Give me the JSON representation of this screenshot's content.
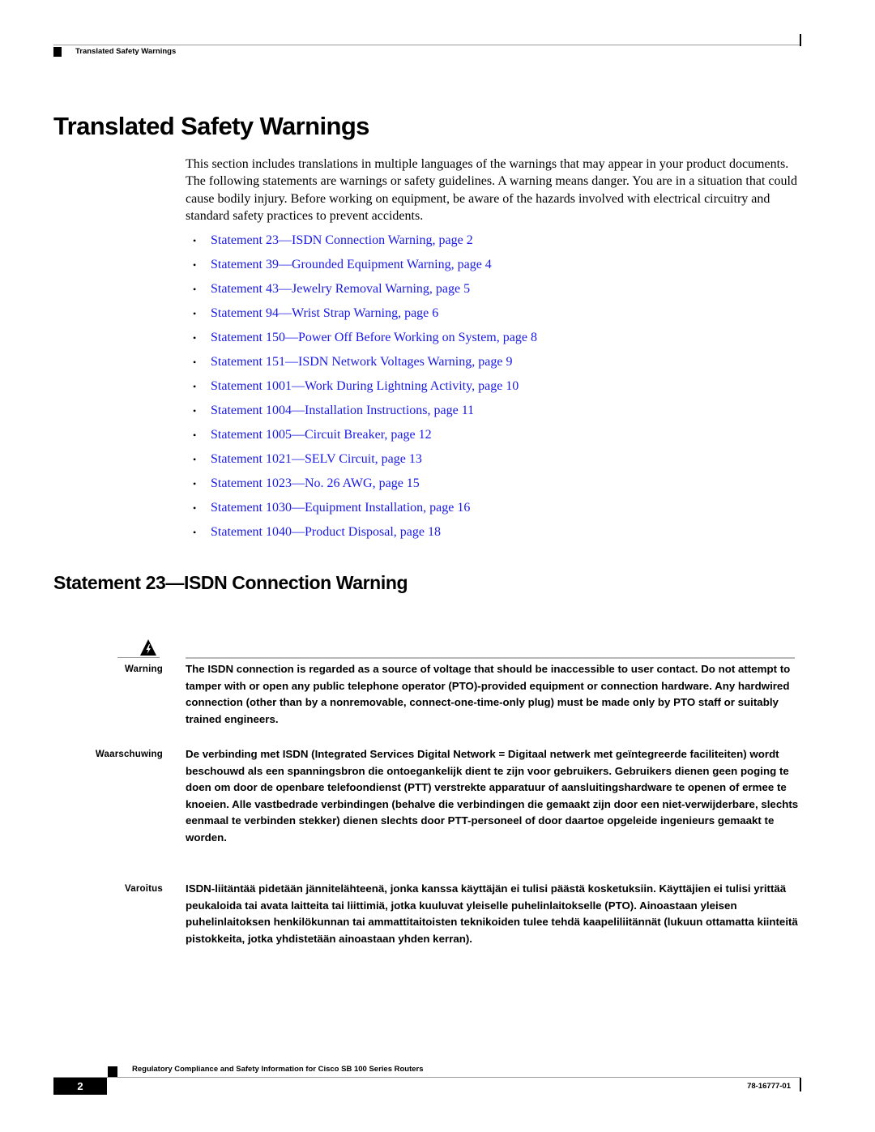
{
  "header": {
    "running_title": "Translated Safety Warnings"
  },
  "page_title": "Translated Safety Warnings",
  "intro": "This section includes translations in multiple languages of the warnings that may appear in your product documents. The following statements are warnings or safety guidelines. A warning means danger. You are in a situation that could cause bodily injury. Before working on equipment, be aware of the hazards involved with electrical circuitry and standard safety practices to prevent accidents.",
  "toc": [
    {
      "label": "Statement 23—ISDN Connection Warning, page 2"
    },
    {
      "label": "Statement 39—Grounded Equipment Warning, page 4"
    },
    {
      "label": "Statement 43—Jewelry Removal Warning, page 5"
    },
    {
      "label": "Statement 94—Wrist Strap Warning, page 6"
    },
    {
      "label": "Statement 150—Power Off Before Working on System, page 8"
    },
    {
      "label": "Statement 151—ISDN Network Voltages Warning, page 9"
    },
    {
      "label": "Statement 1001—Work During Lightning Activity, page 10"
    },
    {
      "label": "Statement 1004—Installation Instructions, page 11"
    },
    {
      "label": "Statement 1005—Circuit Breaker, page 12"
    },
    {
      "label": "Statement 1021—SELV Circuit, page 13"
    },
    {
      "label": "Statement 1023—No. 26 AWG, page 15"
    },
    {
      "label": "Statement 1030—Equipment Installation, page 16"
    },
    {
      "label": "Statement 1040—Product Disposal, page 18"
    }
  ],
  "link_color": "#1a1ae6",
  "section": {
    "title": "Statement 23—ISDN Connection Warning",
    "icon": "warning-electrical-hazard-icon",
    "warnings": [
      {
        "label": "Warning",
        "text": "The ISDN connection is regarded as a source of voltage that should be inaccessible to user contact. Do not attempt to tamper with or open any public telephone operator (PTO)-provided equipment or connection hardware. Any hardwired connection (other than by a nonremovable, connect-one-time-only plug) must be made only by PTO staff or suitably trained engineers."
      },
      {
        "label": "Waarschuwing",
        "text": "De verbinding met ISDN (Integrated Services Digital Network = Digitaal netwerk met geïntegreerde faciliteiten) wordt beschouwd als een spanningsbron die ontoegankelijk dient te zijn voor gebruikers. Gebruikers dienen geen poging te doen om door de openbare telefoondienst (PTT) verstrekte apparatuur of aansluitingshardware te openen of ermee te knoeien. Alle vastbedrade verbindingen (behalve die verbindingen die gemaakt zijn door een niet-verwijderbare, slechts eenmaal te verbinden stekker) dienen slechts door PTT-personeel of door daartoe opgeleide ingenieurs gemaakt te worden."
      },
      {
        "label": "Varoitus",
        "text": "ISDN-liitäntää pidetään jännitelähteenä, jonka kanssa käyttäjän ei tulisi päästä kosketuksiin. Käyttäjien ei tulisi yrittää peukaloida tai avata laitteita tai liittimiä, jotka kuuluvat yleiselle puhelinlaitokselle (PTO). Ainoastaan yleisen puhelinlaitoksen henkilökunnan tai ammattitaitoisten teknikoiden tulee tehdä kaapeliliitännät (lukuun ottamatta kiinteitä pistokkeita, jotka yhdistetään ainoastaan yhden kerran)."
      }
    ]
  },
  "footer": {
    "book_title": "Regulatory Compliance and Safety Information for Cisco SB 100 Series Routers",
    "page_number": "2",
    "doc_number": "78-16777-01"
  }
}
